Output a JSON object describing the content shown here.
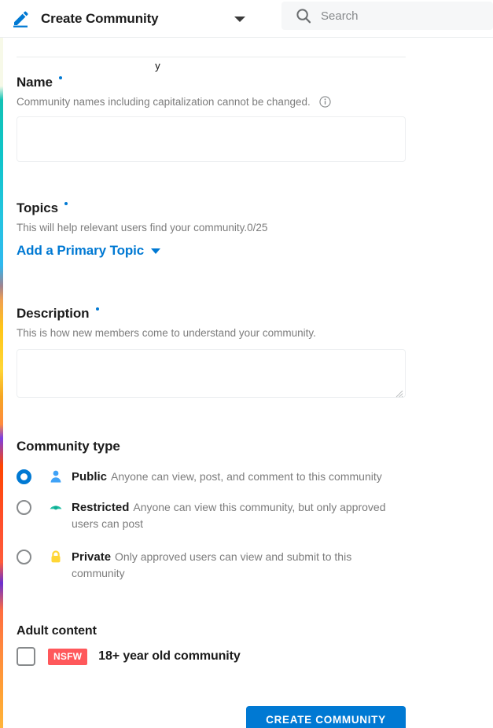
{
  "header": {
    "pen_icon": "edit-pen-icon",
    "title": "Create Community",
    "chevron": "chevron-down-icon",
    "search": {
      "icon": "search-icon",
      "placeholder": "Search",
      "value": ""
    }
  },
  "clipped_top_text": "y",
  "name_section": {
    "label": "Name",
    "required_marker": "•",
    "helper": "Community names including capitalization cannot be changed.",
    "info_icon": "info-circle-icon",
    "input_value": "",
    "input_placeholder": ""
  },
  "topics_section": {
    "label": "Topics",
    "required_marker": "•",
    "helper": "This will help relevant users find your community.0/25",
    "counter": "0/25",
    "add_topic_link": "Add a Primary Topic"
  },
  "description_section": {
    "label": "Description",
    "required_marker": "•",
    "helper": "This is how new members come to understand your community.",
    "textarea_value": "",
    "textarea_placeholder": ""
  },
  "community_type": {
    "label": "Community type",
    "selected": "public",
    "options": [
      {
        "id": "public",
        "icon": "person-icon",
        "icon_color": "#3FA2F7",
        "name": "Public",
        "description": "Anyone can view, post, and comment to this community",
        "checked": true
      },
      {
        "id": "restricted",
        "icon": "eye-icon",
        "icon_color": "#24C0A5",
        "name": "Restricted",
        "description": "Anyone can view this community, but only approved users can post",
        "checked": false
      },
      {
        "id": "private",
        "icon": "lock-icon",
        "icon_color": "#FFD635",
        "name": "Private",
        "description": "Only approved users can view and submit to this community",
        "checked": false
      }
    ]
  },
  "adult_content": {
    "label": "Adult content",
    "badge": "NSFW",
    "badge_color": "#FF585B",
    "checkbox_label": "18+ year old community",
    "checked": false
  },
  "footer": {
    "submit_label": "CREATE COMMUNITY",
    "submit_color": "#0079D3"
  },
  "colors": {
    "accent": "#0079D3",
    "muted_text": "#7C7C7C",
    "primary_text": "#1C1C1C",
    "border": "#EDEFF1",
    "search_bg": "#F6F7F8"
  }
}
